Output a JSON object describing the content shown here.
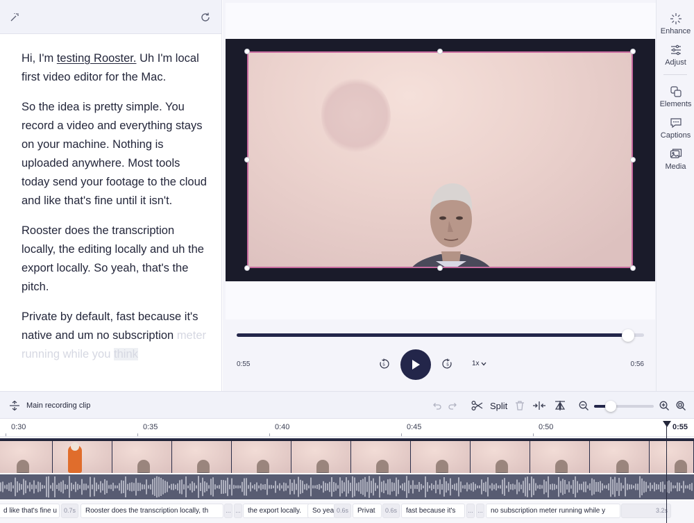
{
  "colors": {
    "accent": "#23264a",
    "selection": "#c76a9f",
    "stage": "#1a1b2a",
    "waveform": "#585c72"
  },
  "transcript": {
    "toolbar_icons": [
      "magic-wand-icon",
      "refresh-icon"
    ],
    "p1_before": "Hi, I'm ",
    "p1_link": "testing Rooster.",
    "p1_after": " Uh I'm local first video editor for the Mac.",
    "p2": "So the idea is pretty simple. You record a video and everything stays on your machine. Nothing is uploaded anywhere. Most tools today send your footage to the cloud and like that's fine until it isn't.",
    "p3": "Rooster does the transcription locally, the editing locally and uh the export locally. So yeah, that's the pitch.",
    "p4": "Private by default, fast because it's native and um no subscription",
    "p4_faded": "meter running while you",
    "p4_faded_hl": "think"
  },
  "player": {
    "current_time": "0:55",
    "end_time": "0:56",
    "speed": "1x",
    "progress": 0.96,
    "skip_back_label": "5",
    "skip_forward_label": "5"
  },
  "sidebar": {
    "items": [
      {
        "label": "Enhance",
        "icon": "sparkle-icon"
      },
      {
        "label": "Adjust",
        "icon": "sliders-icon"
      },
      {
        "label": "Elements",
        "icon": "shapes-icon"
      },
      {
        "label": "Captions",
        "icon": "caption-bubble-icon"
      },
      {
        "label": "Media",
        "icon": "image-stack-icon"
      }
    ]
  },
  "timeline": {
    "clip_title": "Main recording clip",
    "split_label": "Split",
    "zoom_level": 0.28,
    "ruler": [
      "0:30",
      "0:35",
      "0:40",
      "0:45",
      "0:50"
    ],
    "playhead": "0:55"
  },
  "captions": [
    {
      "text": "d like that's fine u",
      "gap": "0.7s"
    },
    {
      "text": "Rooster does the transcription locally, th",
      "gap": "..."
    },
    {
      "text": "",
      "gap": "..."
    },
    {
      "text": "the export locally.",
      "gap": ""
    },
    {
      "text": "So yea",
      "gap": "0.6s"
    },
    {
      "text": "Privat",
      "gap": "0.6s"
    },
    {
      "text": "fast because it's",
      "gap": "..."
    },
    {
      "text": "",
      "gap": "..."
    },
    {
      "text": "no subscription meter running while y",
      "gap": "3.2s"
    }
  ]
}
